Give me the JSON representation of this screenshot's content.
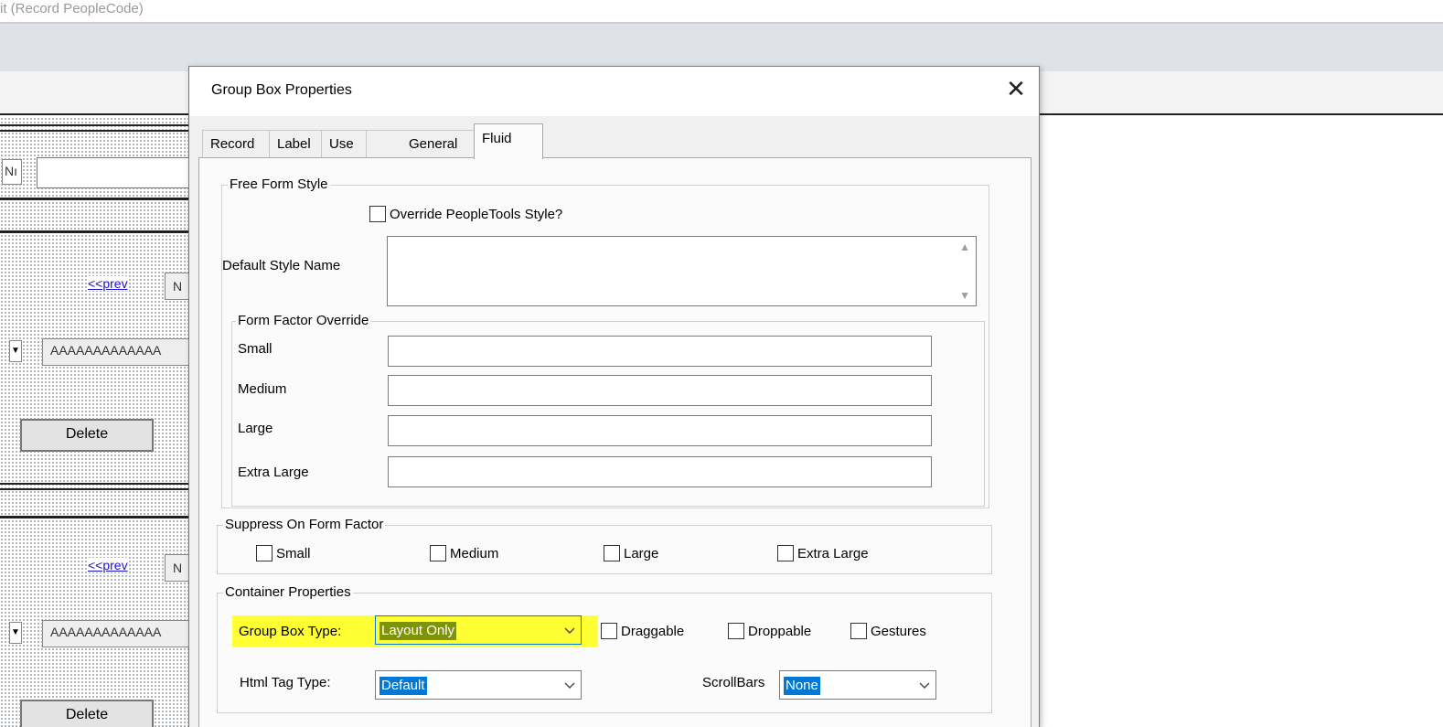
{
  "background_app": {
    "window_title": "it (Record PeopleCode)",
    "field_stub": "Nı",
    "links": [
      "<<prev",
      "<<prev"
    ],
    "nav_stubs": [
      "N",
      "N"
    ],
    "fields": [
      "AAAAAAAAAAAAA",
      "AAAAAAAAAAAAA"
    ],
    "buttons": [
      "Delete",
      "Delete"
    ]
  },
  "dialog": {
    "title": "Group Box Properties",
    "close_glyph": "✕",
    "tabs": [
      {
        "label": "Record",
        "active": false
      },
      {
        "label": "Label",
        "active": false
      },
      {
        "label": "Use",
        "active": false
      },
      {
        "label": "General",
        "active": false
      },
      {
        "label": "Fluid",
        "active": true
      }
    ],
    "free_form_style": {
      "legend": "Free Form Style",
      "override_checkbox": {
        "label": "Override PeopleTools Style?",
        "checked": false
      },
      "default_style_label": "Default Style Name",
      "default_style_value": "",
      "scroll_up": "▲",
      "scroll_down": "▼",
      "form_factor_override": {
        "legend": "Form Factor Override",
        "rows": [
          {
            "label": "Small",
            "value": ""
          },
          {
            "label": "Medium",
            "value": ""
          },
          {
            "label": "Large",
            "value": ""
          },
          {
            "label": "Extra Large",
            "value": ""
          }
        ]
      }
    },
    "suppress_on_form_factor": {
      "legend": "Suppress On Form Factor",
      "options": [
        {
          "label": "Small",
          "checked": false
        },
        {
          "label": "Medium",
          "checked": false
        },
        {
          "label": "Large",
          "checked": false
        },
        {
          "label": "Extra Large",
          "checked": false
        }
      ]
    },
    "container_properties": {
      "legend": "Container Properties",
      "group_box_type": {
        "label": "Group Box Type:",
        "value": "Layout Only"
      },
      "draggable": {
        "label": "Draggable",
        "checked": false
      },
      "droppable": {
        "label": "Droppable",
        "checked": false
      },
      "gestures": {
        "label": "Gestures",
        "checked": false
      },
      "html_tag_type": {
        "label": "Html Tag Type:",
        "value": "Default"
      },
      "scrollbars": {
        "label": "ScrollBars",
        "value": "None"
      }
    }
  },
  "colors": {
    "highlight": "#ffff33",
    "selection": "#0078d7",
    "dialog_bg": "#f0f0f0"
  }
}
